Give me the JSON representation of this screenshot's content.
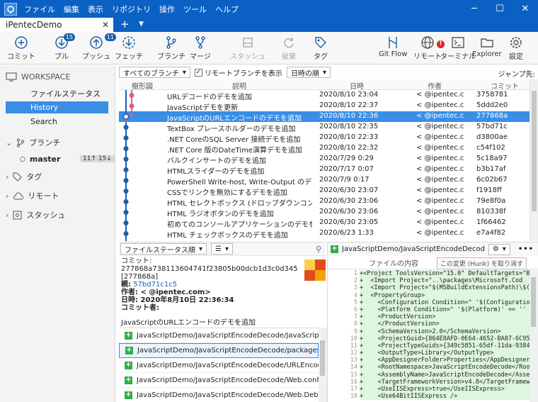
{
  "menu": [
    "ファイル",
    "編集",
    "表示",
    "リポジトリ",
    "操作",
    "ツール",
    "ヘルプ"
  ],
  "tab": {
    "title": "iPentecDemo"
  },
  "toolbar": {
    "commit": "コミット",
    "pull": "プル",
    "pull_badge": "15",
    "push": "プッシュ",
    "push_badge": "11",
    "fetch": "フェッチ",
    "branch": "ブランチ",
    "merge": "マージ",
    "stash": "スタッシュ",
    "discard": "破棄",
    "tag": "タグ",
    "gitflow": "Git Flow",
    "remote": "リモート",
    "remote_alert": "!",
    "terminal": "ターミナル",
    "explorer": "Explorer",
    "settings": "設定"
  },
  "sidebar": {
    "workspace": "WORKSPACE",
    "items": [
      "ファイルステータス",
      "History",
      "Search"
    ],
    "branches": "ブランチ",
    "master": "master",
    "master_badge": "11↑ 15↓",
    "tags": "タグ",
    "remotes": "リモート",
    "stashes": "スタッシュ"
  },
  "filters": {
    "branches": "すべてのブランチ",
    "show_remote": "リモートブランチを表示",
    "order": "日時の順",
    "jump": "ジャンプ先:"
  },
  "columns": {
    "graph": "樹形図",
    "desc": "説明",
    "date": "日時",
    "author": "作者",
    "commit": "コミット"
  },
  "commits": [
    {
      "desc": "URLデコードのデモを追加",
      "date": "2020/8/10  23:04",
      "author": "<          @ipentec.c",
      "hash": "3758781"
    },
    {
      "desc": "JavaScriptデモを更新",
      "date": "2020/8/10  22:37",
      "author": "<          @ipentec.c",
      "hash": "5ddd2e0"
    },
    {
      "desc": "JavaScriptのURLエンコードのデモを追加",
      "date": "2020/8/10  22:36",
      "author": "<          @ipentec.c",
      "hash": "277868a"
    },
    {
      "desc": "TextBox プレースホルダーのデモを追加",
      "date": "2020/8/10  22:35",
      "author": "<          @ipentec.c",
      "hash": "57bd71c"
    },
    {
      "desc": ".NET CoreのSQL Server 接続デモを追加",
      "date": "2020/8/10  22:33",
      "author": "<          @ipentec.c",
      "hash": "d3800ae"
    },
    {
      "desc": ".NET Core 版のDateTime演算デモを追加",
      "date": "2020/8/10  22:32",
      "author": "<          @ipentec.c",
      "hash": "c54f102"
    },
    {
      "desc": "バルクインサートのデモを追加",
      "date": "2020/7/29  0:29",
      "author": "<          @ipentec.c",
      "hash": "5c18a97"
    },
    {
      "desc": "HTMLスライダーのデモを追加",
      "date": "2020/7/17  0:07",
      "author": "<          @ipentec.c",
      "hash": "b3b17af"
    },
    {
      "desc": "PowerShell Write-host, Write-Output のデモを追加",
      "date": "2020/7/9  0:17",
      "author": "<          @ipentec.c",
      "hash": "6c02b67"
    },
    {
      "desc": "CSSでリンクを無効にするデモを追加",
      "date": "2020/6/30  23:07",
      "author": "<          @ipentec.c",
      "hash": "f1918ff"
    },
    {
      "desc": "HTML セレクトボックス (ドロップダウンコンボボックス)のデ",
      "date": "2020/6/30  23:06",
      "author": "<          @ipentec.c",
      "hash": "79e8f0a"
    },
    {
      "desc": "HTML ラジオボタンのデモを追加",
      "date": "2020/6/30  23:06",
      "author": "<          @ipentec.c",
      "hash": "810338f"
    },
    {
      "desc": "初めてのコンソールアプリケーションのデモを追加",
      "date": "2020/6/30  23:05",
      "author": "<          @ipentec.c",
      "hash": "1f66462"
    },
    {
      "desc": "HTML チェックボックスのデモを追加",
      "date": "2020/6/23  1:33",
      "author": "<          @ipentec.c",
      "hash": "e7a4f82"
    }
  ],
  "details": {
    "sort": "ファイルステータス順",
    "commit": "コミット: 277868a738113604741f23805b00dcb1d3c0d345 [277868a]",
    "parent_label": "親:",
    "parent": "57bd71c1c5",
    "author": "作者:          <          @ipentec.com>",
    "date": "日時: 2020年8月10日 22:36:34",
    "committer": "コミット者:",
    "message": "JavaScriptのURLエンコードのデモを追加"
  },
  "files": [
    "JavaScriptDemo/JavaScriptEncodeDecode/JavaScriptEnco...",
    "JavaScriptDemo/JavaScriptEncodeDecode/packages.config",
    "JavaScriptDemo/JavaScriptEncodeDecode/URLEncode.html",
    "JavaScriptDemo/JavaScriptEncodeDecode/Web.config",
    "JavaScriptDemo/JavaScriptEncodeDecode/Web.Debug.co..."
  ],
  "diff": {
    "path": "JavaScriptDemo/JavaScriptEncodeDecode/Ja...",
    "contents_label": "ファイルの内容",
    "hunk_button": "この変更 (Hunk) を取り消す",
    "lines": [
      {
        "n": "1",
        "code": "+<Project ToolsVersion=\"15.0\" DefaultTargets=\"B"
      },
      {
        "n": "2",
        "code": "+  <Import Project=\"..\\packages\\Microsoft.Cod"
      },
      {
        "n": "3",
        "code": "+  <Import Project=\"$(MSBuildExtensionsPath)\\$("
      },
      {
        "n": "4",
        "code": "+  <PropertyGroup>"
      },
      {
        "n": "5",
        "code": "+    <Configuration Condition=\" '$(Configuration"
      },
      {
        "n": "6",
        "code": "+    <Platform Condition=\" '$(Platform)' == ''"
      },
      {
        "n": "7",
        "code": "+    <ProductVersion>"
      },
      {
        "n": "8",
        "code": "+    </ProductVersion>"
      },
      {
        "n": "9",
        "code": "+    <SchemaVersion>2.0</SchemaVersion>"
      },
      {
        "n": "10",
        "code": "+    <ProjectGuid>{864E8AFD-0E64-4652-BA87-6C95"
      },
      {
        "n": "11",
        "code": "+    <ProjectTypeGuids>{349c5851-65df-11da-9384"
      },
      {
        "n": "12",
        "code": "+    <OutputType>Library</OutputType>"
      },
      {
        "n": "13",
        "code": "+    <AppDesignerFolder>Properties</AppDesigner"
      },
      {
        "n": "14",
        "code": "+    <RootNamespace>JavaScriptEncodeDecode</Roo"
      },
      {
        "n": "15",
        "code": "+    <AssemblyName>JavaScriptEncodeDecode</Asse"
      },
      {
        "n": "16",
        "code": "+    <TargetFrameworkVersion>v4.8</TargetFramew"
      },
      {
        "n": "17",
        "code": "+    <UseIISExpress>true</UseIISExpress>"
      },
      {
        "n": "18",
        "code": "+    <Use64BitIISExpress />"
      }
    ]
  }
}
